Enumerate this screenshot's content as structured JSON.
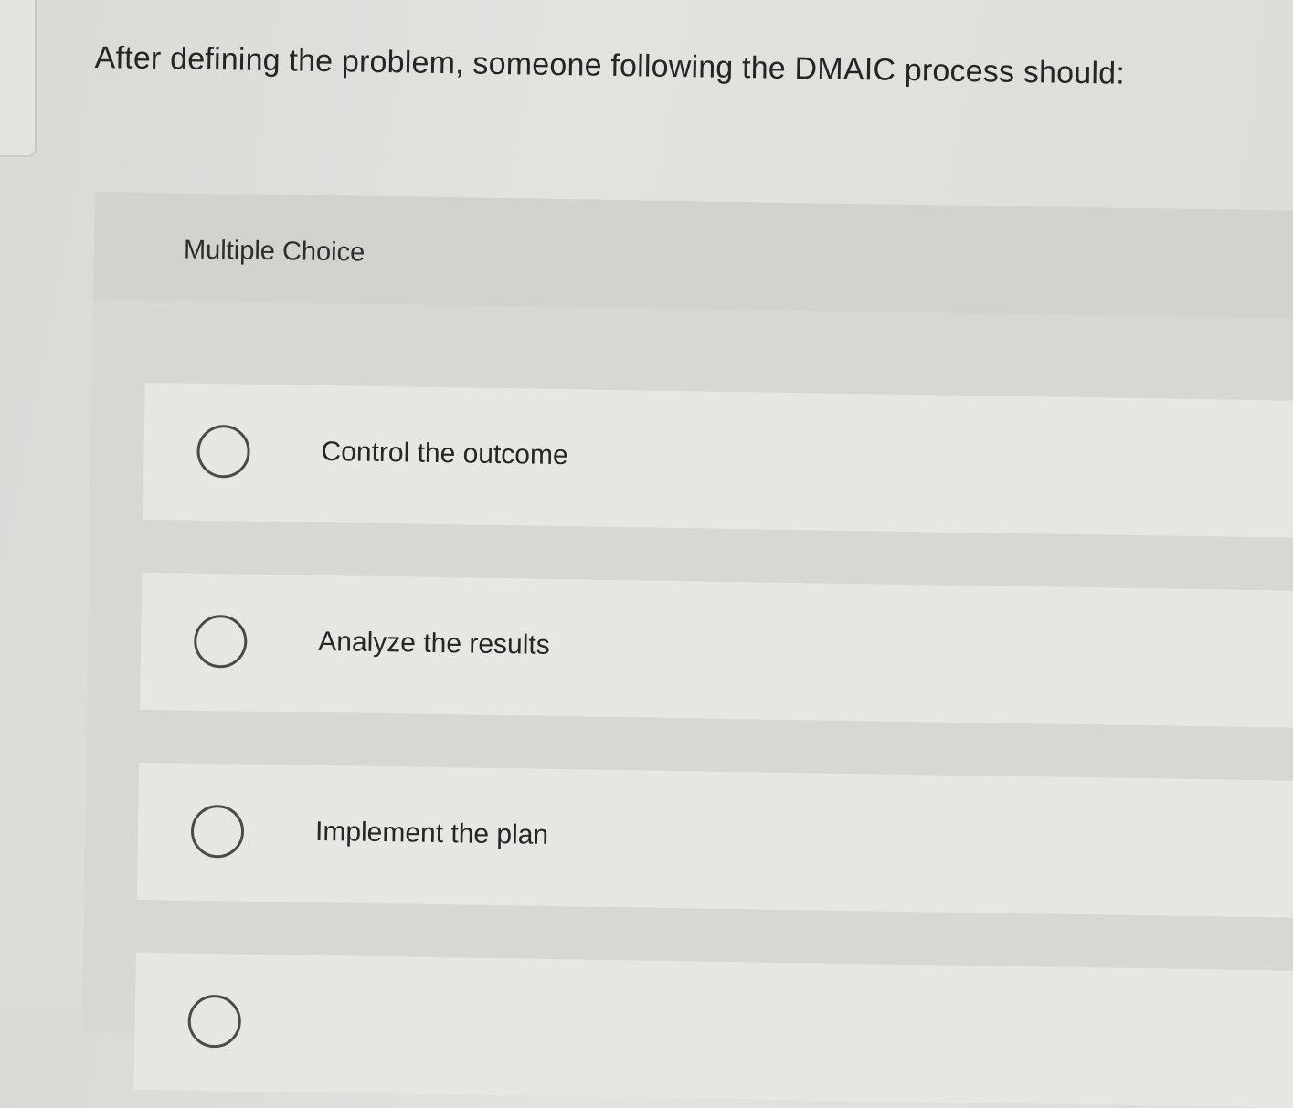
{
  "question": {
    "text": "After defining the problem, someone following the DMAIC process should:"
  },
  "multiple_choice": {
    "label": "Multiple Choice",
    "options": [
      {
        "label": "Control the outcome"
      },
      {
        "label": "Analyze the results"
      },
      {
        "label": "Implement the plan"
      },
      {
        "label": ""
      }
    ]
  },
  "colors": {
    "background": "#dedeD9",
    "option_background": "#e6e6e2",
    "text": "#262626",
    "radio_border": "#4a4a4a"
  }
}
